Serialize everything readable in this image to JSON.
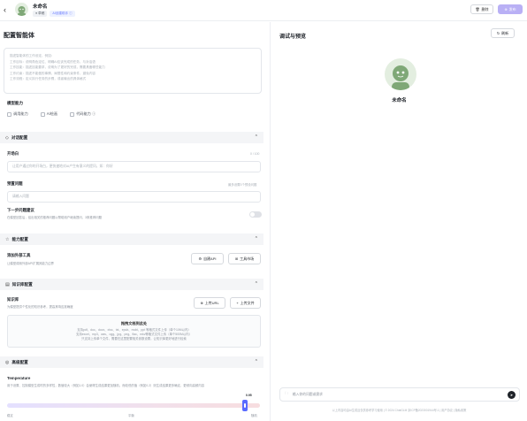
{
  "header": {
    "back_icon": "chevron-left-icon",
    "app_name": "未命名",
    "tags": [
      "● 草稿",
      "AI创建助手 ⓘ"
    ],
    "delete_label": "删除",
    "publish_label": "发布"
  },
  "config": {
    "title": "配置智能体",
    "prompt_placeholder_lines": [
      "描述智能体的工作设定，例如：",
      "  工作目标：说明角色定位、明确AI应该完成的任务，与对话语",
      "  工作技能：描述技能要求，说明为了更好的完成，需要具备哪些能力",
      "  工作约束：描述不能做的事情、局限性和约束条件，避免内容",
      "  工作流程：定义执行任务的步骤，或者输出的具体格式"
    ],
    "capability_label": "模型能力",
    "capabilities": [
      "调用能力",
      "AI绘画",
      "代码能力 ⓘ"
    ]
  },
  "dialog": {
    "section_title": "对话配置",
    "opening_label": "开场白",
    "opening_count": "0 / 100",
    "opening_placeholder": "让用户通过你的开场白，更快速地对AI产生有意义的提问，如：你好",
    "preset_label": "预置问题",
    "preset_hint": "最多设置3个预设问题",
    "preset_placeholder": "请输入问题",
    "next_label": "下一步问题建议",
    "next_desc": "在模型回答后，给出相关的推荐问题以帮助用户继续提问，3条推荐问题"
  },
  "skills": {
    "section_title": "能力配置",
    "tool_label": "添加外部工具",
    "tool_desc": "让模型调用外部API扩展其能力边界",
    "btn_api": "自建API",
    "btn_tool": "工具市场"
  },
  "knowledge": {
    "section_title": "知识库配置",
    "kb_label": "知识库",
    "kb_desc": "为模型提供个性化的知识参考，提高其响应准确度",
    "btn_url": "上传URL",
    "btn_file": "上传文件",
    "upload_title": "拖拽文档到此处",
    "upload_lines": [
      "支持pdf、doc、docx、xlsx、txt、epub、mobi、ppt 等格式文件上传（单个10M以内）",
      "支持excel、mp3、wav、ogg、jpg、png、flac、mkv等格式文件上传（单个500M以内）",
      "只支持上传单个文件，需要在这里配置相关参数设置，让知识库更好地进行检索"
    ]
  },
  "advanced": {
    "section_title": "高级配置",
    "temp_label": "Temperature",
    "temp_desc": "用于设置、控制模型生成时的多样性，数值较大（例如1.0）会使得生成结果更加随机，而较低的值（例如0.2）则生成结果更多确定，更倾向高频内容",
    "temp_value": "0.95",
    "temp_fraction": 0.95,
    "scale": [
      "稳定",
      "平衡",
      "随机"
    ]
  },
  "preview": {
    "title": "调试与预览",
    "refresh_label": "刷新",
    "bot_name": "未命名",
    "input_placeholder": "输入你的问题或需求",
    "footer": "以上内容均由AI生成且仅供参考学习使用 | © 2024 ChatGLM 京ICP备2023001944号-1 | 用户协议 | 隐私政策"
  },
  "colors": {
    "accent": "#5a6bff",
    "publish_disabled": "#b9b0f5",
    "section_bg": "#f4f5f7"
  }
}
